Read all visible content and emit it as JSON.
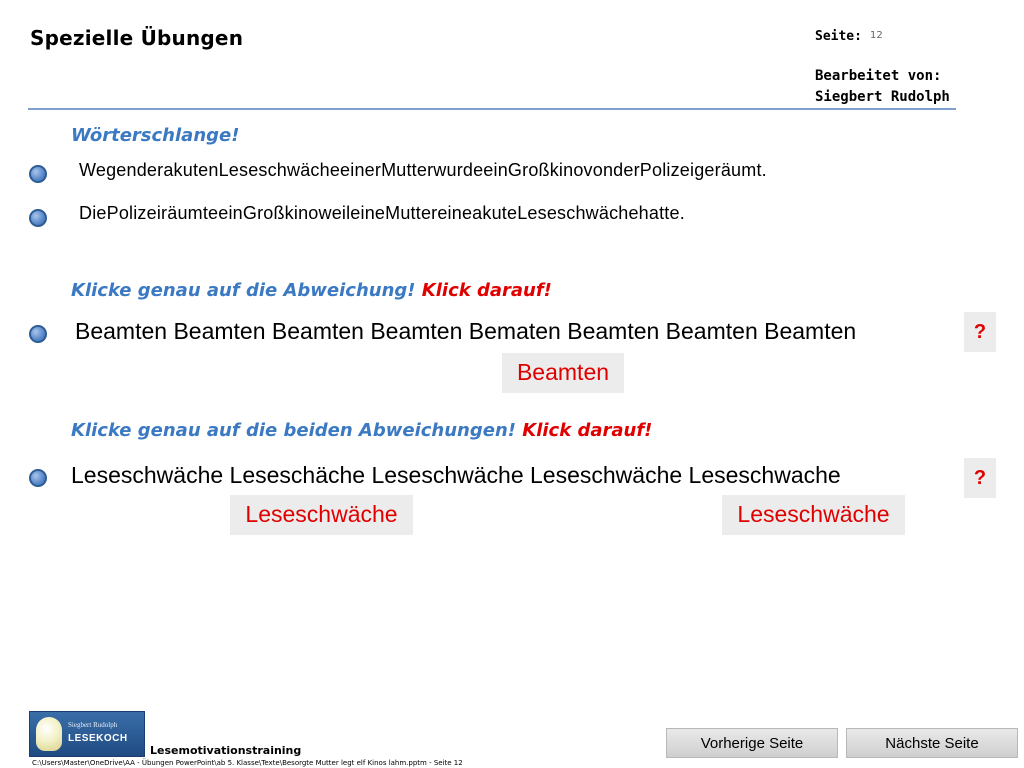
{
  "header": {
    "title": "Spezielle Übungen",
    "page_label": "Seite:",
    "page_number": "12",
    "editor_label": "Bearbeitet von:",
    "editor_name": "Siegbert Rudolph"
  },
  "section1": {
    "instruction": "Wörterschlange!",
    "sentences": [
      "WegenderakutenLeseschwächeeinerMutterwurdeeinGroßkinovonderPolizeigeräumt.",
      "DiePolizeiräumteeinGroßkinoweileineMuttereineakuteLeseschwächehatte."
    ]
  },
  "section2": {
    "instruction": "Klicke genau auf  die Abweichung! ",
    "instruction_highlight": "Klick darauf!",
    "words": "Beamten Beamten Beamten Beamten Bematen Beamten Beamten Beamten",
    "question_label": "?",
    "answer": "Beamten"
  },
  "section3": {
    "instruction": "Klicke genau auf die beiden Abweichungen! ",
    "instruction_highlight": "Klick darauf!",
    "words": "Leseschwäche Leseschäche Leseschwäche Leseschwäche Leseschwache",
    "question_label": "?",
    "answers": [
      "Leseschwäche",
      "Leseschwäche"
    ]
  },
  "footer": {
    "logo_line1": "Siegbert Rudolph",
    "logo_line2": "LESEKOCH",
    "brand": "Lesemotivationstraining",
    "path": "C:\\Users\\Master\\OneDrive\\AA - Übungen PowerPoint\\ab 5. Klasse\\Texte\\Besorgte Mutter legt elf Kinos lahm.pptm - Seite 12",
    "prev_label": "Vorherige Seite",
    "next_label": "Nächste Seite"
  },
  "colors": {
    "accent_blue": "#3b79c2",
    "highlight_red": "#e00000",
    "rule": "#7f9fcf"
  }
}
